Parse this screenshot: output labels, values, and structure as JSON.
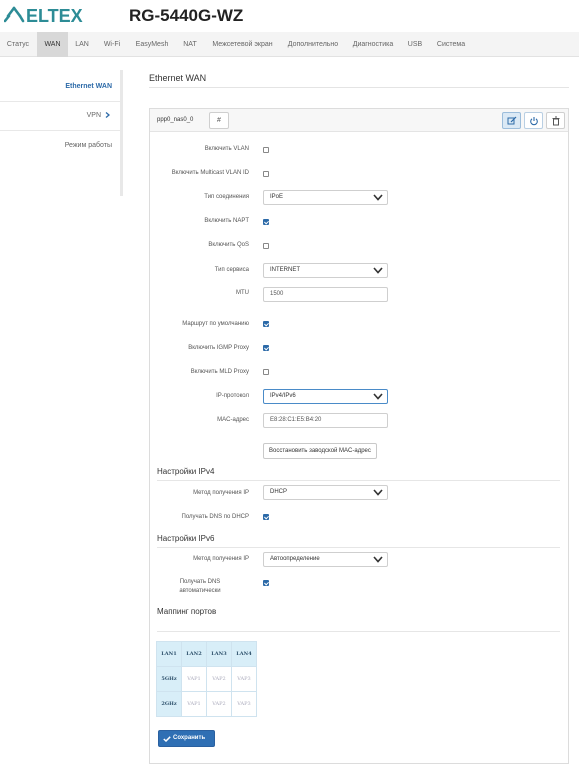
{
  "header": {
    "brand": "ELTEX",
    "model": "RG-5440G-WZ"
  },
  "topnav": {
    "tabs": [
      {
        "label": "Статус"
      },
      {
        "label": "WAN",
        "active": true
      },
      {
        "label": "LAN"
      },
      {
        "label": "Wi-Fi"
      },
      {
        "label": "EasyMesh"
      },
      {
        "label": "NAT"
      },
      {
        "label": "Межсетевой экран"
      },
      {
        "label": "Дополнительно"
      },
      {
        "label": "Диагностика"
      },
      {
        "label": "USB"
      },
      {
        "label": "Система"
      }
    ]
  },
  "sidebar": {
    "items": [
      {
        "label": "Ethernet WAN",
        "active": true
      },
      {
        "label": "VPN"
      },
      {
        "label": "Режим работы"
      }
    ]
  },
  "page": {
    "title": "Ethernet WAN"
  },
  "panel": {
    "iface_name": "ppp0_nas0_0",
    "hash_label": "#",
    "fields": {
      "vlan_label": "Включить VLAN",
      "vlan_checked": false,
      "mcast_vlan_label": "Включить Multicast VLAN ID",
      "mcast_vlan_checked": false,
      "conn_type_label": "Тип соединения",
      "conn_type_value": "IPoE",
      "napt_label": "Включить NAPT",
      "napt_checked": true,
      "qos_label": "Включить QoS",
      "qos_checked": false,
      "service_label": "Тип сервиса",
      "service_value": "INTERNET",
      "mtu_label": "MTU",
      "mtu_value": "1500",
      "default_route_label": "Маршрут по умолчанию",
      "default_route_checked": true,
      "igmp_label": "Включить IGMP Proxy",
      "igmp_checked": true,
      "mld_label": "Включить MLD Proxy",
      "mld_checked": false,
      "ip_proto_label": "IP-протокол",
      "ip_proto_value": "IPv4/IPv6",
      "mac_label": "MAC-адрес",
      "mac_value": "E8:28:C1:E5:B4:20",
      "restore_mac_label": "Восстановить заводской MAC-адрес"
    },
    "ipv4": {
      "title": "Настройки IPv4",
      "method_label": "Метод получения IP",
      "method_value": "DHCP",
      "dns_label": "Получать DNS по DHCP",
      "dns_checked": true
    },
    "ipv6": {
      "title": "Настройки IPv6",
      "method_label": "Метод получения IP",
      "method_value": "Автоопределение",
      "dns_label_1": "Получать DNS",
      "dns_label_2": "автоматически",
      "dns_checked": true
    },
    "port_mapping": {
      "title": "Маппинг портов",
      "header": [
        "LAN1",
        "LAN2",
        "LAN3",
        "LAN4"
      ],
      "rows": [
        {
          "band": "5GHz",
          "cells": [
            "VAP1",
            "VAP2",
            "VAP3"
          ]
        },
        {
          "band": "2GHz",
          "cells": [
            "VAP1",
            "VAP2",
            "VAP3"
          ]
        }
      ]
    },
    "save_label": "Сохранить"
  },
  "colors": {
    "accent": "#2f6fb4",
    "brand": "#2d8c96",
    "active_link": "#2c6aa8"
  }
}
